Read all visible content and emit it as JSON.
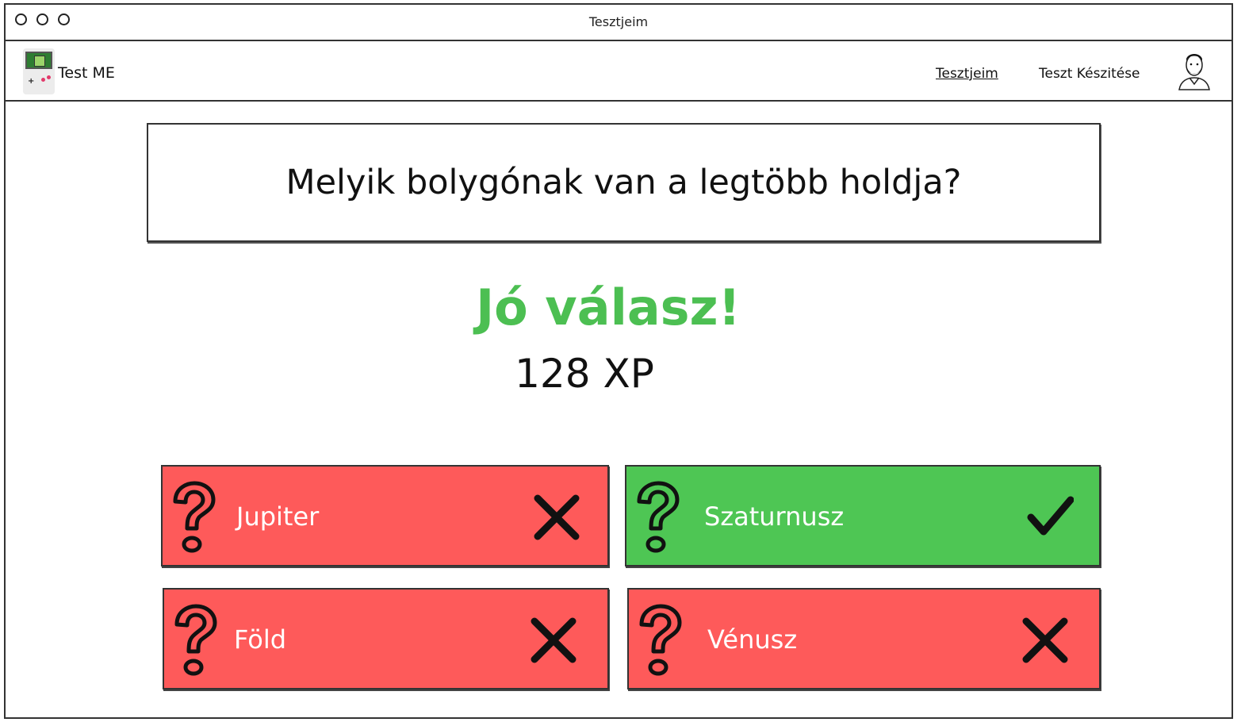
{
  "window": {
    "title": "Tesztjeim"
  },
  "navbar": {
    "brand": "Test ME",
    "links": [
      {
        "label": "Tesztjeim",
        "active": true
      },
      {
        "label": "Teszt Készitése",
        "active": false
      }
    ]
  },
  "quiz": {
    "question": "Melyik bolygónak van a legtöbb holdja?",
    "result_text": "Jó válasz!",
    "score": "128 XP",
    "answers": [
      {
        "label": "Jupiter",
        "status": "wrong"
      },
      {
        "label": "Szaturnusz",
        "status": "correct"
      },
      {
        "label": "Föld",
        "status": "wrong"
      },
      {
        "label": "Vénusz",
        "status": "wrong"
      }
    ]
  },
  "colors": {
    "correct": "#4ec654",
    "wrong": "#fe5a5a",
    "result_text": "#4cbf52"
  },
  "icons": {
    "answer_prefix": "question-mark-icon",
    "correct_mark": "check-icon",
    "wrong_mark": "x-icon"
  }
}
